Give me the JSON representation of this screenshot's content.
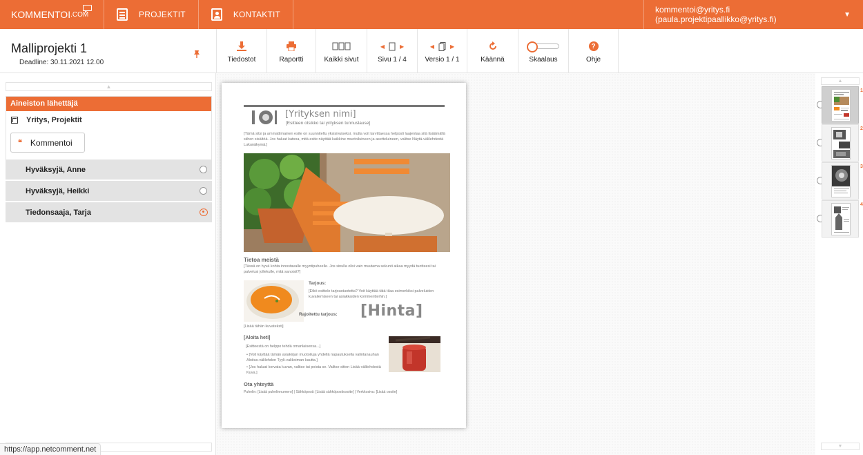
{
  "nav": {
    "logo_main": "KOMMENTOI",
    "logo_suffix": ".COM",
    "projects": "PROJEKTIT",
    "contacts": "KONTAKTIT",
    "account": "kommentoi@yritys.fi (paula.projektipaallikko@yritys.fi)",
    "account_caret": "▼"
  },
  "project": {
    "title": "Malliprojekti 1",
    "deadline": "Deadline: 30.11.2021 12.00"
  },
  "toolbar": {
    "files": "Tiedostot",
    "report": "Raportti",
    "all_pages": "Kaikki sivut",
    "page": "Sivu 1 / 4",
    "version": "Versio 1 / 1",
    "rotate": "Käännä",
    "zoom": "Skaalaus",
    "help": "Ohje",
    "help_glyph": "?"
  },
  "sidebar": {
    "sender_header": "Aineiston lähettäjä",
    "sender_name": "Yritys, Projektit",
    "comment_button": "Kommentoi",
    "approvers": [
      {
        "name": "Hyväksyjä, Anne",
        "status": "radio"
      },
      {
        "name": "Hyväksyjä, Heikki",
        "status": "radio"
      },
      {
        "name": "Tiedonsaaja, Tarja",
        "status": "eye"
      }
    ]
  },
  "document": {
    "company": "[Yrityksen nimi]",
    "tagline": "[Esitteen otsikko tai yrityksen tunnuslause]",
    "intro": "[Tämä sitsi ja ammattimainen esite on suunniteltu yksisivuiseksi, mutta voit tarvittaessa helposti laajentaa sitä lisäämällä siihen sisältöä. Jos haluat katsoa, mitä esite näyttää kaikkine muotoiluineen ja asetteluineen, valitse Näytä-välilehdestä Lukunäkymä.]",
    "about_heading": "Tietoa meistä",
    "about_text": "[Tässä on hyvä kohta innostavalle myyntipuheelle. Jos sinulla olisi vain muutama sekunti aikaa myydä tuotteesi tai palvelusi jollekulle, mitä sanoisit?]",
    "offer_heading": "Tarjous:",
    "offer_text": "[Etkö esittele tarjoustuotetta? Voit käyttää tätä tilaa esimerkiksi palveluiden kuvailemiseen tai asiakkaiden kommentteihin.]",
    "limited_offer": "Rajoitettu tarjous:",
    "price": "[Hinta]",
    "caption": "[Lisää tähän kuvateksti]",
    "start_heading": "[Aloita heti]",
    "start_text": "[Esitteestä on helppo tehdä omanlaisensa...]",
    "bullet1": "[Voit käyttää tämän asiakirjan muotoiluja yhdellä napautuksella valintanauhan Aloitus-välilehden Tyyli-valikoiman kautta.]",
    "bullet2": "[Jos haluat korvata kuvan, valitse tai poista se. Valitse sitten Lisää-välilehdestä Kuva.]",
    "contact_heading": "Ota yhteyttä",
    "contact_text": "Puhelin: [Lisää puhelinnumero] | Sähköposti: [Lisää sähköpostiosoite] | Verkkosivu: [Lisää osoite]"
  },
  "thumbnails": [
    {
      "num": "1",
      "selected": true
    },
    {
      "num": "2",
      "selected": false
    },
    {
      "num": "3",
      "selected": false
    },
    {
      "num": "4",
      "selected": false
    }
  ],
  "status_url": "https://app.netcomment.net",
  "colors": {
    "accent": "#ec6d35",
    "row_bg": "#e3e3e3"
  }
}
